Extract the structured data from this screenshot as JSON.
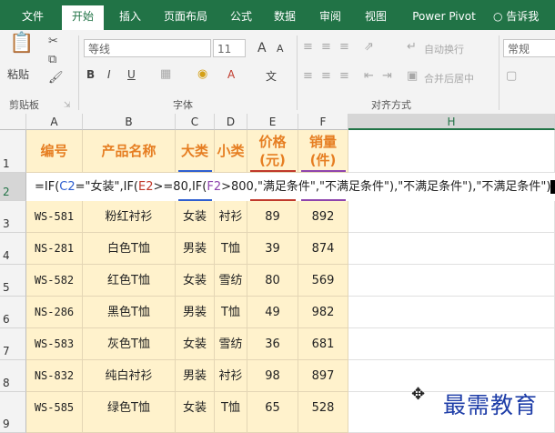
{
  "tabs": [
    "文件",
    "开始",
    "插入",
    "页面布局",
    "公式",
    "数据",
    "审阅",
    "视图",
    "Power Pivot",
    "告诉我"
  ],
  "active_tab": "开始",
  "ribbon": {
    "paste_label": "粘贴",
    "clipboard_group": "剪贴板",
    "font_name": "等线",
    "font_size": "11",
    "font_group": "字体",
    "wrap_text": "自动换行",
    "merge_center": "合并后居中",
    "align_group": "对齐方式",
    "number_format": "常规",
    "bold": "B",
    "italic": "I",
    "underline": "U",
    "grow_font": "A",
    "shrink_font": "A",
    "wen_label": "文"
  },
  "columns": [
    "A",
    "B",
    "C",
    "D",
    "E",
    "F",
    "H"
  ],
  "active_column": "H",
  "row_numbers": [
    "1",
    "2",
    "3",
    "4",
    "5",
    "6",
    "7",
    "8",
    "9"
  ],
  "active_row": "2",
  "headers": [
    "编号",
    "产品名称",
    "大类",
    "小类",
    "价格\n(元)",
    "销量\n(件)"
  ],
  "formula_parts": [
    {
      "text": "=IF(",
      "cls": ""
    },
    {
      "text": "C2",
      "cls": "f-blue"
    },
    {
      "text": "=\"女装\",IF(",
      "cls": ""
    },
    {
      "text": "E2",
      "cls": "f-red"
    },
    {
      "text": ">=80,IF(",
      "cls": ""
    },
    {
      "text": "F2",
      "cls": "f-purple"
    },
    {
      "text": ">800,\"满足条件\",\"不满足条件\"),\"不满足条件\"),\"不满足条件\")",
      "cls": ""
    }
  ],
  "rows": [
    [
      "WS-581",
      "粉红衬衫",
      "女装",
      "衬衫",
      "89",
      "892"
    ],
    [
      "NS-281",
      "白色T恤",
      "男装",
      "T恤",
      "39",
      "874"
    ],
    [
      "WS-582",
      "红色T恤",
      "女装",
      "雪纺",
      "80",
      "569"
    ],
    [
      "NS-286",
      "黑色T恤",
      "男装",
      "T恤",
      "49",
      "982"
    ],
    [
      "WS-583",
      "灰色T恤",
      "女装",
      "雪纺",
      "36",
      "681"
    ],
    [
      "NS-832",
      "纯白衬衫",
      "男装",
      "衬衫",
      "98",
      "897"
    ],
    [
      "WS-585",
      "绿色T恤",
      "女装",
      "T恤",
      "65",
      "528"
    ]
  ],
  "watermark": "最需教育",
  "colors": {
    "excel_green": "#217346",
    "header_text": "#e67e22",
    "cell_fill": "#fff2cc",
    "watermark": "#1f3ea8"
  }
}
